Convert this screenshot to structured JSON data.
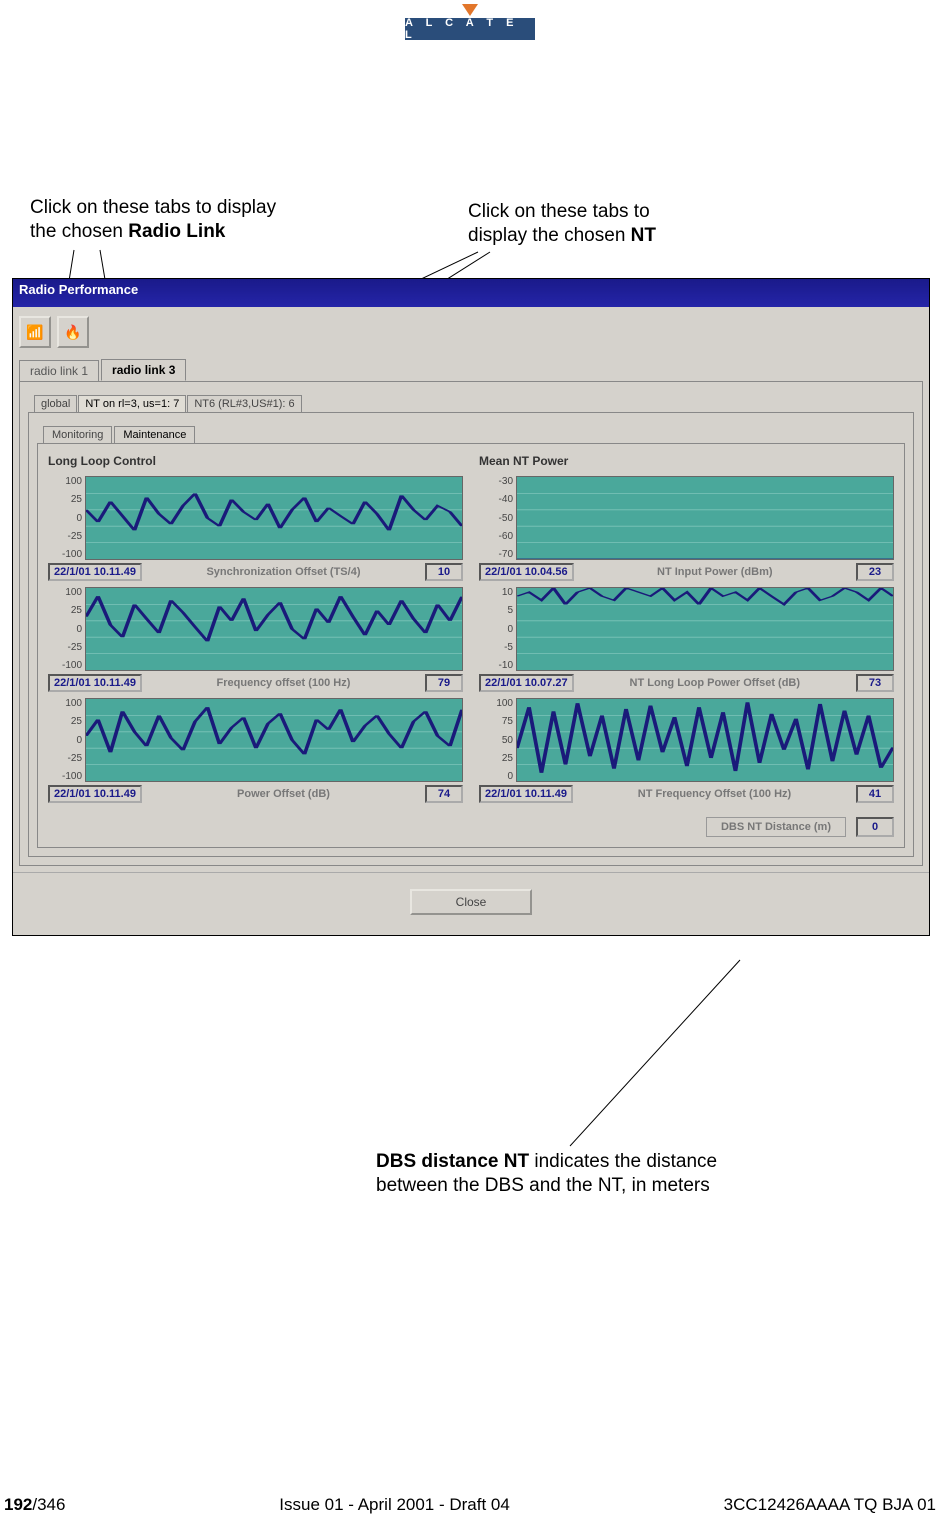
{
  "brand": "A L C A T E L",
  "annotations": {
    "left": {
      "pre": "Click on these tabs to display\nthe chosen ",
      "bold": "Radio Link"
    },
    "right": {
      "pre": "Click on these tabs to\ndisplay the chosen ",
      "bold": "NT"
    },
    "bottom": {
      "bold": "DBS distance NT",
      "post": " indicates the distance\nbetween the DBS and the NT, in meters"
    }
  },
  "window": {
    "title": "Radio Performance",
    "radioTabs": [
      {
        "label": "radio link 1"
      },
      {
        "label": "radio link 3",
        "active": true
      }
    ],
    "ntTabs": [
      {
        "label": "global"
      },
      {
        "label": "NT on rl=3, us=1: 7",
        "active": true
      },
      {
        "label": "NT6 (RL#3,US#1): 6"
      }
    ],
    "viewTabs": [
      {
        "label": "Monitoring"
      },
      {
        "label": "Maintenance",
        "active": true
      }
    ],
    "groups": {
      "left": "Long Loop Control",
      "right": "Mean NT Power"
    },
    "distance": {
      "label": "DBS NT Distance (m)",
      "value": "0"
    },
    "close": "Close"
  },
  "chart_data": [
    {
      "type": "line",
      "title": "Synchronization Offset (TS/4)",
      "timestamp": "22/1/01 10.11.49",
      "value": "10",
      "yticks": [
        "100",
        "25",
        "0",
        "-25",
        "-100"
      ],
      "ylim": [
        -100,
        100
      ],
      "series": [
        {
          "name": "offset",
          "values": [
            20,
            -10,
            40,
            5,
            -30,
            50,
            10,
            -15,
            30,
            60,
            0,
            -20,
            45,
            15,
            -5,
            35,
            -25,
            20,
            50,
            -10,
            25,
            5,
            -15,
            40,
            10,
            -30,
            55,
            20,
            -5,
            30,
            15,
            -20
          ]
        }
      ]
    },
    {
      "type": "line",
      "title": "Frequency offset (100 Hz)",
      "timestamp": "22/1/01 10.11.49",
      "value": "79",
      "yticks": [
        "100",
        "25",
        "0",
        "-25",
        "-100"
      ],
      "ylim": [
        -100,
        100
      ],
      "series": [
        {
          "name": "freq",
          "values": [
            30,
            80,
            10,
            -20,
            60,
            25,
            -10,
            70,
            40,
            5,
            -30,
            55,
            20,
            75,
            -5,
            35,
            65,
            0,
            -25,
            50,
            15,
            80,
            30,
            -15,
            45,
            10,
            70,
            25,
            -10,
            60,
            20,
            79
          ]
        }
      ]
    },
    {
      "type": "line",
      "title": "Power Offset (dB)",
      "timestamp": "22/1/01 10.11.49",
      "value": "74",
      "yticks": [
        "100",
        "25",
        "0",
        "-25",
        "-100"
      ],
      "ylim": [
        -100,
        100
      ],
      "series": [
        {
          "name": "pow",
          "values": [
            10,
            50,
            -30,
            70,
            20,
            -15,
            60,
            5,
            -25,
            45,
            80,
            -10,
            30,
            55,
            -20,
            40,
            65,
            0,
            -35,
            50,
            25,
            75,
            -5,
            35,
            60,
            15,
            -20,
            45,
            70,
            10,
            -15,
            74
          ]
        }
      ]
    },
    {
      "type": "line",
      "title": "NT Input Power (dBm)",
      "timestamp": "22/1/01 10.04.56",
      "value": "23",
      "yticks": [
        "-30",
        "-40",
        "-50",
        "-60",
        "-70"
      ],
      "ylim": [
        -70,
        -30
      ],
      "series": [
        {
          "name": "inpw",
          "values": [
            -70,
            -70,
            -70,
            -70,
            -70,
            -70,
            -70,
            -70,
            -70,
            -70,
            -70,
            -70,
            -70,
            -70,
            -70,
            -70,
            -70,
            -70,
            -70,
            -70,
            -70,
            -70,
            -70,
            -70,
            -70,
            -70,
            -70,
            -70,
            -70,
            -70,
            -70,
            -70
          ]
        }
      ]
    },
    {
      "type": "line",
      "title": "NT Long Loop Power Offset (dB)",
      "timestamp": "22/1/01 10.07.27",
      "value": "73",
      "yticks": [
        "10",
        "5",
        "0",
        "-5",
        "-10"
      ],
      "ylim": [
        -10,
        10
      ],
      "series": [
        {
          "name": "llpo",
          "values": [
            8,
            9,
            7,
            10,
            6,
            9,
            10,
            8,
            7,
            10,
            9,
            8,
            10,
            7,
            9,
            6,
            10,
            8,
            9,
            7,
            10,
            8,
            6,
            9,
            10,
            7,
            8,
            10,
            9,
            7,
            10,
            8
          ]
        }
      ]
    },
    {
      "type": "line",
      "title": "NT Frequency Offset (100 Hz)",
      "timestamp": "22/1/01 10.11.49",
      "value": "41",
      "yticks": [
        "100",
        "75",
        "50",
        "25",
        "0"
      ],
      "ylim": [
        0,
        100
      ],
      "series": [
        {
          "name": "ntfo",
          "values": [
            40,
            90,
            10,
            85,
            20,
            95,
            30,
            80,
            15,
            88,
            25,
            92,
            35,
            78,
            18,
            90,
            28,
            84,
            12,
            96,
            22,
            82,
            38,
            76,
            14,
            94,
            24,
            86,
            32,
            80,
            16,
            41
          ]
        }
      ]
    }
  ],
  "footer": {
    "page_cur": "192",
    "page_total": "/346",
    "issue": "Issue 01 - April 2001 - Draft 04",
    "doc": "3CC12426AAAA TQ BJA 01"
  }
}
